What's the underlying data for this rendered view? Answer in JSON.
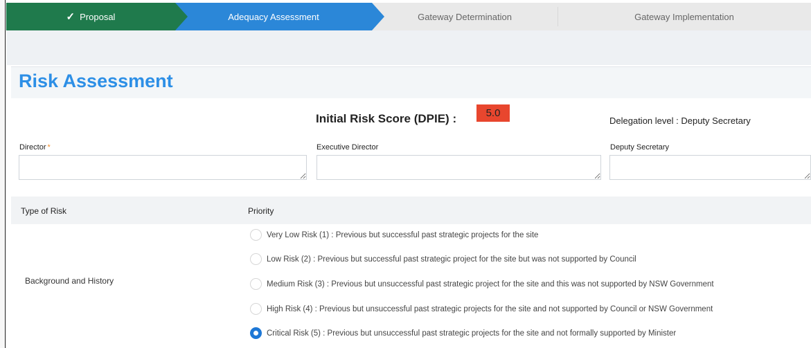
{
  "stepper": {
    "steps": [
      {
        "label": "Proposal",
        "state": "completed"
      },
      {
        "label": "Adequacy Assessment",
        "state": "active"
      },
      {
        "label": "Gateway Determination",
        "state": "upcoming"
      },
      {
        "label": "Gateway Implementation",
        "state": "upcoming"
      }
    ],
    "check_glyph": "✓"
  },
  "section": {
    "title": "Risk Assessment"
  },
  "risk_score": {
    "label": "Initial Risk Score (DPIE) :",
    "value": "5.0",
    "value_color": "#e8462e"
  },
  "delegation": {
    "text": "Delegation level :  Deputy Secretary"
  },
  "fields": {
    "director": {
      "label": "Director",
      "required_mark": "*",
      "value": ""
    },
    "executive_director": {
      "label": "Executive Director",
      "value": ""
    },
    "deputy_secretary": {
      "label": "Deputy Secretary",
      "value": ""
    }
  },
  "table": {
    "headers": [
      "Type of Risk",
      "Priority"
    ],
    "row_label": "Background and History",
    "options": [
      {
        "text": "Very Low Risk (1) : Previous but successful past strategic projects for the site",
        "checked": false
      },
      {
        "text": "Low Risk (2) : Previous but successful past strategic project for the site but was not supported by Council",
        "checked": false
      },
      {
        "text": "Medium Risk (3) : Previous but unsuccessful past strategic project for the site and this was not supported by NSW Government",
        "checked": false
      },
      {
        "text": "High Risk (4) : Previous but unsuccessful past strategic projects for the site and not supported by Council or NSW Government",
        "checked": false
      },
      {
        "text": "Critical Risk (5) : Previous but unsuccessful past strategic projects for the site and not formally supported by Minister",
        "checked": true
      }
    ]
  },
  "colors": {
    "completed_step": "#1f7a4c",
    "active_step": "#2b87d8",
    "accent": "#2d8fe6",
    "radio_checked": "#1e78d6",
    "required": "#f28c28"
  }
}
